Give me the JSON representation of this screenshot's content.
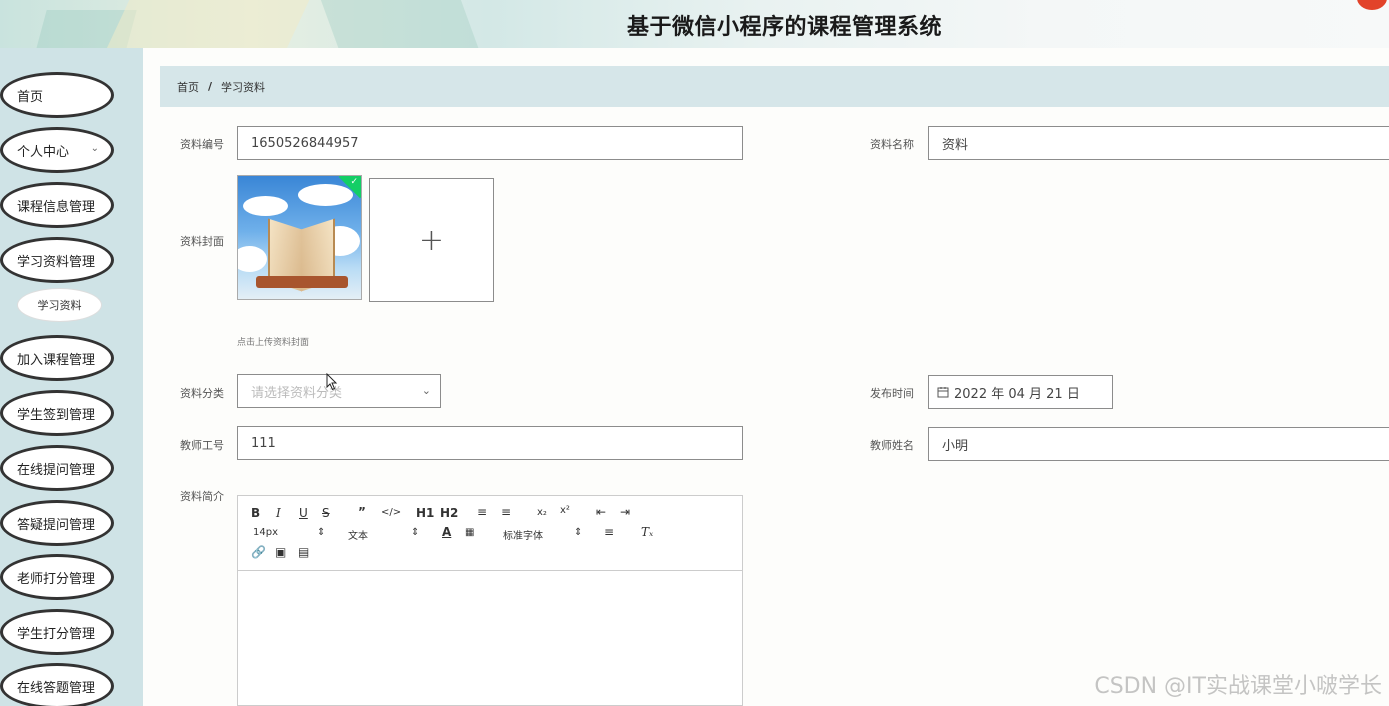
{
  "header": {
    "title": "基于微信小程序的课程管理系统"
  },
  "sidebar": {
    "items": [
      {
        "label": "首页"
      },
      {
        "label": "个人中心"
      },
      {
        "label": "课程信息管理"
      },
      {
        "label": "学习资料管理"
      },
      {
        "label": "加入课程管理"
      },
      {
        "label": "学生签到管理"
      },
      {
        "label": "在线提问管理"
      },
      {
        "label": "答疑提问管理"
      },
      {
        "label": "老师打分管理"
      },
      {
        "label": "学生打分管理"
      },
      {
        "label": "在线答题管理"
      }
    ],
    "submenu": {
      "label": "学习资料"
    },
    "chevron_icon": "chevron-down-icon"
  },
  "breadcrumb": {
    "home": "首页",
    "separator": "/",
    "current": "学习资料"
  },
  "form": {
    "code_label": "资料编号",
    "code_value": "1650526844957",
    "name_label": "资料名称",
    "name_value": "资料",
    "cover_label": "资料封面",
    "cover_hint": "点击上传资料封面",
    "category_label": "资料分类",
    "category_placeholder": "请选择资料分类",
    "publish_label": "发布时间",
    "publish_value": "2022 年 04 月 21 日",
    "teacher_no_label": "教师工号",
    "teacher_no_value": "111",
    "teacher_name_label": "教师姓名",
    "teacher_name_value": "小明",
    "intro_label": "资料简介"
  },
  "editor": {
    "font_size": "14px",
    "text_style": "文本",
    "font_family": "标准字体",
    "h1": "H1",
    "h2": "H2"
  },
  "watermark": "CSDN @IT实战课堂小啵学长",
  "colors": {
    "sidebar_bg": "#cfe3e6",
    "breadcrumb_bg": "#d6e6e9",
    "success_badge": "#13ce66"
  }
}
